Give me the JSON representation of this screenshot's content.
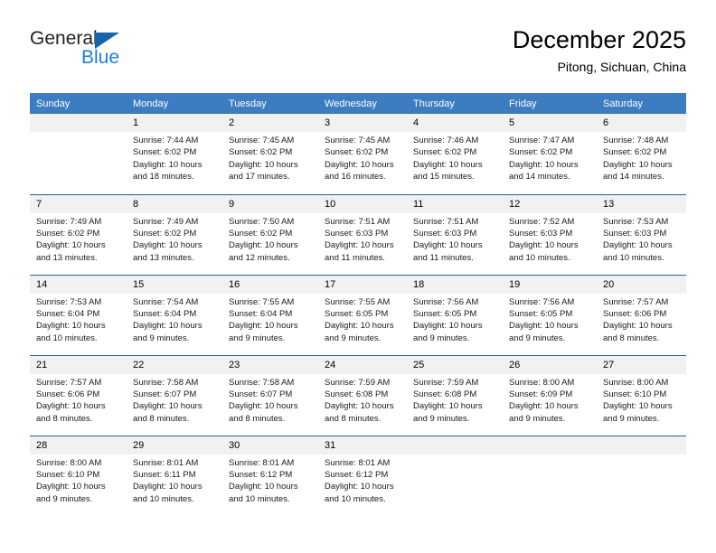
{
  "brand": {
    "name_top": "General",
    "name_bottom": "Blue",
    "triangle_color": "#1565a8",
    "blue_color": "#1b7fd4"
  },
  "header": {
    "title": "December 2025",
    "subtitle": "Pitong, Sichuan, China"
  },
  "colors": {
    "header_bg": "#3b7dc0",
    "daynum_bg": "#f1f1f1",
    "row_border": "#2c5f93",
    "text": "#000000"
  },
  "weekday_headers": [
    "Sunday",
    "Monday",
    "Tuesday",
    "Wednesday",
    "Thursday",
    "Friday",
    "Saturday"
  ],
  "labels": {
    "sunrise_prefix": "Sunrise: ",
    "sunset_prefix": "Sunset: ",
    "daylight_prefix": "Daylight: "
  },
  "weeks": [
    [
      {
        "day": "",
        "sunrise": "",
        "sunset": "",
        "daylight_line1": "",
        "daylight_line2": ""
      },
      {
        "day": "1",
        "sunrise": "Sunrise: 7:44 AM",
        "sunset": "Sunset: 6:02 PM",
        "daylight_line1": "Daylight: 10 hours",
        "daylight_line2": "and 18 minutes."
      },
      {
        "day": "2",
        "sunrise": "Sunrise: 7:45 AM",
        "sunset": "Sunset: 6:02 PM",
        "daylight_line1": "Daylight: 10 hours",
        "daylight_line2": "and 17 minutes."
      },
      {
        "day": "3",
        "sunrise": "Sunrise: 7:45 AM",
        "sunset": "Sunset: 6:02 PM",
        "daylight_line1": "Daylight: 10 hours",
        "daylight_line2": "and 16 minutes."
      },
      {
        "day": "4",
        "sunrise": "Sunrise: 7:46 AM",
        "sunset": "Sunset: 6:02 PM",
        "daylight_line1": "Daylight: 10 hours",
        "daylight_line2": "and 15 minutes."
      },
      {
        "day": "5",
        "sunrise": "Sunrise: 7:47 AM",
        "sunset": "Sunset: 6:02 PM",
        "daylight_line1": "Daylight: 10 hours",
        "daylight_line2": "and 14 minutes."
      },
      {
        "day": "6",
        "sunrise": "Sunrise: 7:48 AM",
        "sunset": "Sunset: 6:02 PM",
        "daylight_line1": "Daylight: 10 hours",
        "daylight_line2": "and 14 minutes."
      }
    ],
    [
      {
        "day": "7",
        "sunrise": "Sunrise: 7:49 AM",
        "sunset": "Sunset: 6:02 PM",
        "daylight_line1": "Daylight: 10 hours",
        "daylight_line2": "and 13 minutes."
      },
      {
        "day": "8",
        "sunrise": "Sunrise: 7:49 AM",
        "sunset": "Sunset: 6:02 PM",
        "daylight_line1": "Daylight: 10 hours",
        "daylight_line2": "and 13 minutes."
      },
      {
        "day": "9",
        "sunrise": "Sunrise: 7:50 AM",
        "sunset": "Sunset: 6:02 PM",
        "daylight_line1": "Daylight: 10 hours",
        "daylight_line2": "and 12 minutes."
      },
      {
        "day": "10",
        "sunrise": "Sunrise: 7:51 AM",
        "sunset": "Sunset: 6:03 PM",
        "daylight_line1": "Daylight: 10 hours",
        "daylight_line2": "and 11 minutes."
      },
      {
        "day": "11",
        "sunrise": "Sunrise: 7:51 AM",
        "sunset": "Sunset: 6:03 PM",
        "daylight_line1": "Daylight: 10 hours",
        "daylight_line2": "and 11 minutes."
      },
      {
        "day": "12",
        "sunrise": "Sunrise: 7:52 AM",
        "sunset": "Sunset: 6:03 PM",
        "daylight_line1": "Daylight: 10 hours",
        "daylight_line2": "and 10 minutes."
      },
      {
        "day": "13",
        "sunrise": "Sunrise: 7:53 AM",
        "sunset": "Sunset: 6:03 PM",
        "daylight_line1": "Daylight: 10 hours",
        "daylight_line2": "and 10 minutes."
      }
    ],
    [
      {
        "day": "14",
        "sunrise": "Sunrise: 7:53 AM",
        "sunset": "Sunset: 6:04 PM",
        "daylight_line1": "Daylight: 10 hours",
        "daylight_line2": "and 10 minutes."
      },
      {
        "day": "15",
        "sunrise": "Sunrise: 7:54 AM",
        "sunset": "Sunset: 6:04 PM",
        "daylight_line1": "Daylight: 10 hours",
        "daylight_line2": "and 9 minutes."
      },
      {
        "day": "16",
        "sunrise": "Sunrise: 7:55 AM",
        "sunset": "Sunset: 6:04 PM",
        "daylight_line1": "Daylight: 10 hours",
        "daylight_line2": "and 9 minutes."
      },
      {
        "day": "17",
        "sunrise": "Sunrise: 7:55 AM",
        "sunset": "Sunset: 6:05 PM",
        "daylight_line1": "Daylight: 10 hours",
        "daylight_line2": "and 9 minutes."
      },
      {
        "day": "18",
        "sunrise": "Sunrise: 7:56 AM",
        "sunset": "Sunset: 6:05 PM",
        "daylight_line1": "Daylight: 10 hours",
        "daylight_line2": "and 9 minutes."
      },
      {
        "day": "19",
        "sunrise": "Sunrise: 7:56 AM",
        "sunset": "Sunset: 6:05 PM",
        "daylight_line1": "Daylight: 10 hours",
        "daylight_line2": "and 9 minutes."
      },
      {
        "day": "20",
        "sunrise": "Sunrise: 7:57 AM",
        "sunset": "Sunset: 6:06 PM",
        "daylight_line1": "Daylight: 10 hours",
        "daylight_line2": "and 8 minutes."
      }
    ],
    [
      {
        "day": "21",
        "sunrise": "Sunrise: 7:57 AM",
        "sunset": "Sunset: 6:06 PM",
        "daylight_line1": "Daylight: 10 hours",
        "daylight_line2": "and 8 minutes."
      },
      {
        "day": "22",
        "sunrise": "Sunrise: 7:58 AM",
        "sunset": "Sunset: 6:07 PM",
        "daylight_line1": "Daylight: 10 hours",
        "daylight_line2": "and 8 minutes."
      },
      {
        "day": "23",
        "sunrise": "Sunrise: 7:58 AM",
        "sunset": "Sunset: 6:07 PM",
        "daylight_line1": "Daylight: 10 hours",
        "daylight_line2": "and 8 minutes."
      },
      {
        "day": "24",
        "sunrise": "Sunrise: 7:59 AM",
        "sunset": "Sunset: 6:08 PM",
        "daylight_line1": "Daylight: 10 hours",
        "daylight_line2": "and 8 minutes."
      },
      {
        "day": "25",
        "sunrise": "Sunrise: 7:59 AM",
        "sunset": "Sunset: 6:08 PM",
        "daylight_line1": "Daylight: 10 hours",
        "daylight_line2": "and 9 minutes."
      },
      {
        "day": "26",
        "sunrise": "Sunrise: 8:00 AM",
        "sunset": "Sunset: 6:09 PM",
        "daylight_line1": "Daylight: 10 hours",
        "daylight_line2": "and 9 minutes."
      },
      {
        "day": "27",
        "sunrise": "Sunrise: 8:00 AM",
        "sunset": "Sunset: 6:10 PM",
        "daylight_line1": "Daylight: 10 hours",
        "daylight_line2": "and 9 minutes."
      }
    ],
    [
      {
        "day": "28",
        "sunrise": "Sunrise: 8:00 AM",
        "sunset": "Sunset: 6:10 PM",
        "daylight_line1": "Daylight: 10 hours",
        "daylight_line2": "and 9 minutes."
      },
      {
        "day": "29",
        "sunrise": "Sunrise: 8:01 AM",
        "sunset": "Sunset: 6:11 PM",
        "daylight_line1": "Daylight: 10 hours",
        "daylight_line2": "and 10 minutes."
      },
      {
        "day": "30",
        "sunrise": "Sunrise: 8:01 AM",
        "sunset": "Sunset: 6:12 PM",
        "daylight_line1": "Daylight: 10 hours",
        "daylight_line2": "and 10 minutes."
      },
      {
        "day": "31",
        "sunrise": "Sunrise: 8:01 AM",
        "sunset": "Sunset: 6:12 PM",
        "daylight_line1": "Daylight: 10 hours",
        "daylight_line2": "and 10 minutes."
      },
      {
        "day": "",
        "sunrise": "",
        "sunset": "",
        "daylight_line1": "",
        "daylight_line2": ""
      },
      {
        "day": "",
        "sunrise": "",
        "sunset": "",
        "daylight_line1": "",
        "daylight_line2": ""
      },
      {
        "day": "",
        "sunrise": "",
        "sunset": "",
        "daylight_line1": "",
        "daylight_line2": ""
      }
    ]
  ]
}
